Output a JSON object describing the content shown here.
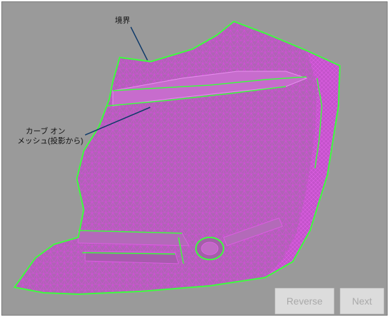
{
  "annotations": {
    "boundary_label": "境界",
    "curve_label_line1": "カーブ オン",
    "curve_label_line2": "メッシュ(投影から)"
  },
  "buttons": {
    "reverse_label": "Reverse",
    "next_label": "Next"
  },
  "colors": {
    "background": "#9a9a9a",
    "mesh": "#d24fd8",
    "boundary": "#3cff3c",
    "leader_line": "#0e3a6a",
    "button_bg": "#dcdcdc",
    "button_text": "#a9a9a9"
  }
}
